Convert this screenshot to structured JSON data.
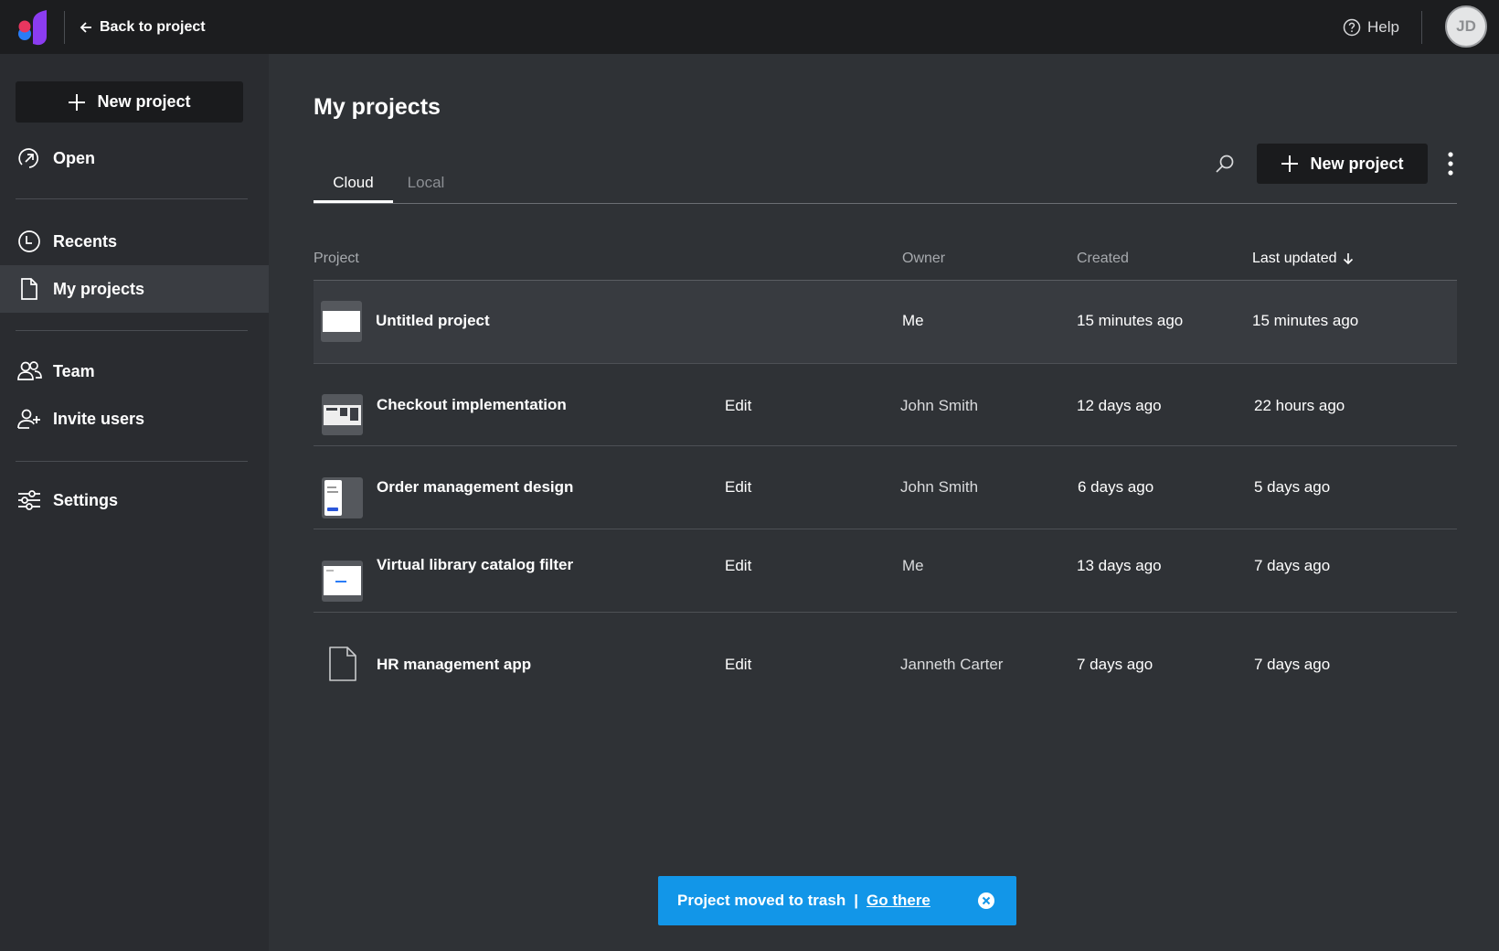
{
  "topbar": {
    "back_label": "Back to project",
    "help_label": "Help",
    "avatar_initials": "JD"
  },
  "sidebar": {
    "new_project_label": "New project",
    "items": [
      {
        "label": "Open",
        "icon": "open-arrow-icon"
      },
      {
        "label": "Recents",
        "icon": "clock-icon"
      },
      {
        "label": "My projects",
        "icon": "document-icon",
        "active": true
      },
      {
        "label": "Team",
        "icon": "team-icon"
      },
      {
        "label": "Invite users",
        "icon": "add-user-icon"
      },
      {
        "label": "Settings",
        "icon": "sliders-icon"
      }
    ]
  },
  "main": {
    "title": "My projects",
    "tabs": [
      {
        "label": "Cloud",
        "active": true
      },
      {
        "label": "Local",
        "active": false
      }
    ],
    "new_project_label": "New project",
    "columns": {
      "project": "Project",
      "owner": "Owner",
      "created": "Created",
      "last_updated": "Last updated"
    },
    "rows": [
      {
        "name": "Untitled project",
        "edit": "",
        "owner": "Me",
        "created": "15 minutes ago",
        "updated": "15 minutes ago",
        "thumb": "blank"
      },
      {
        "name": "Checkout implementation",
        "edit": "Edit",
        "owner": "John Smith",
        "created": "12 days ago",
        "updated": "22 hours ago",
        "thumb": "desktop"
      },
      {
        "name": "Order management design",
        "edit": "Edit",
        "owner": "John Smith",
        "created": "6 days ago",
        "updated": "5 days ago",
        "thumb": "mobile"
      },
      {
        "name": "Virtual library catalog filter",
        "edit": "Edit",
        "owner": "Me",
        "created": "13 days ago",
        "updated": "7 days ago",
        "thumb": "page"
      },
      {
        "name": "HR management app",
        "edit": "Edit",
        "owner": "Janneth Carter",
        "created": "7 days ago",
        "updated": "7 days ago",
        "thumb": "file"
      }
    ]
  },
  "toast": {
    "message": "Project moved to trash",
    "separator": "|",
    "link": "Go there"
  },
  "colors": {
    "toast": "#1296e8",
    "logo_pink": "#e8365f",
    "logo_purple": "#8b3cf0",
    "logo_blue": "#2a7cf7"
  }
}
